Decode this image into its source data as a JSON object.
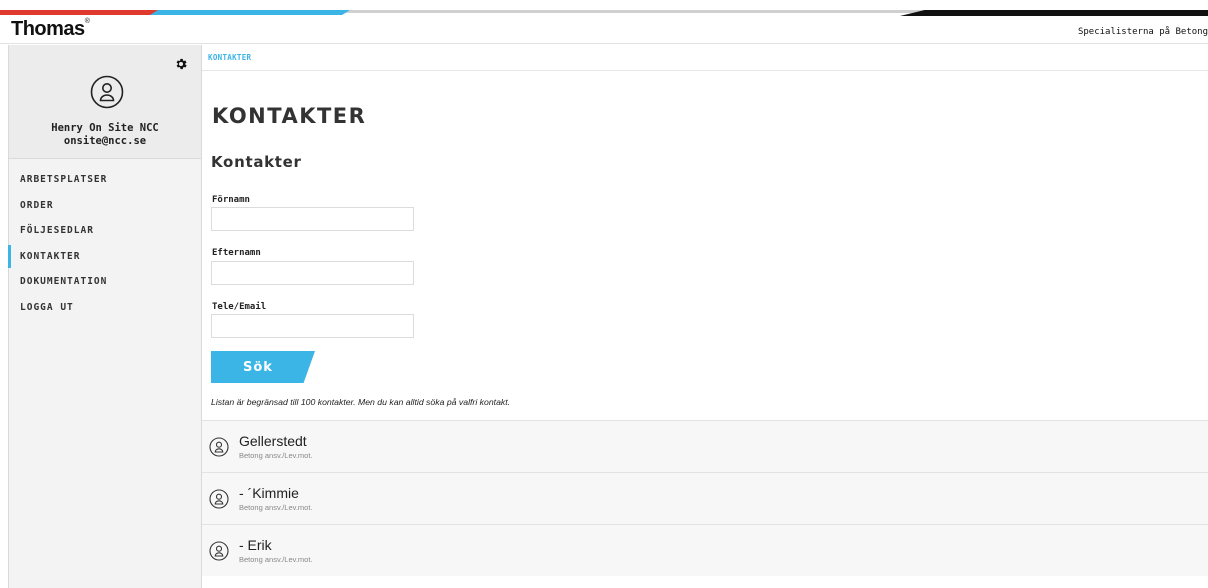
{
  "header": {
    "logo": "Thomas",
    "logo_mark": "®",
    "tagline": "Specialisterna på Betong"
  },
  "sidebar": {
    "settings_icon": "gear-icon",
    "avatar_icon": "user-circle-icon",
    "user_name": "Henry On Site NCC",
    "user_email": "onsite@ncc.se",
    "nav": [
      {
        "label": "ARBETSPLATSER",
        "active": false
      },
      {
        "label": "ORDER",
        "active": false
      },
      {
        "label": "FÖLJESEDLAR",
        "active": false
      },
      {
        "label": "KONTAKTER",
        "active": true
      },
      {
        "label": "DOKUMENTATION",
        "active": false
      },
      {
        "label": "LOGGA UT",
        "active": false
      }
    ]
  },
  "main": {
    "breadcrumb": "KONTAKTER",
    "page_title": "KONTAKTER",
    "section_title": "Kontakter",
    "form": {
      "first_name_label": "Förnamn",
      "first_name_value": "",
      "last_name_label": "Efternamn",
      "last_name_value": "",
      "contact_label": "Tele/Email",
      "contact_value": "",
      "search_button": "Sök"
    },
    "notice": "Listan är begränsad till 100 kontakter. Men du kan alltid söka på valfri kontakt.",
    "contacts": [
      {
        "name": "Gellerstedt",
        "role": "Betong ansv./Lev.mot.",
        "icon": "user-circle-icon"
      },
      {
        "name": "- ´Kimmie",
        "role": "Betong ansv./Lev.mot.",
        "icon": "user-circle-icon"
      },
      {
        "name": "- Erik",
        "role": "Betong ansv./Lev.mot.",
        "icon": "user-circle-icon"
      }
    ]
  },
  "colors": {
    "accent": "#3ab5e6",
    "stripe_red": "#e03a2f",
    "stripe_black": "#111111",
    "sidebar_bg": "#f3f3f3"
  }
}
